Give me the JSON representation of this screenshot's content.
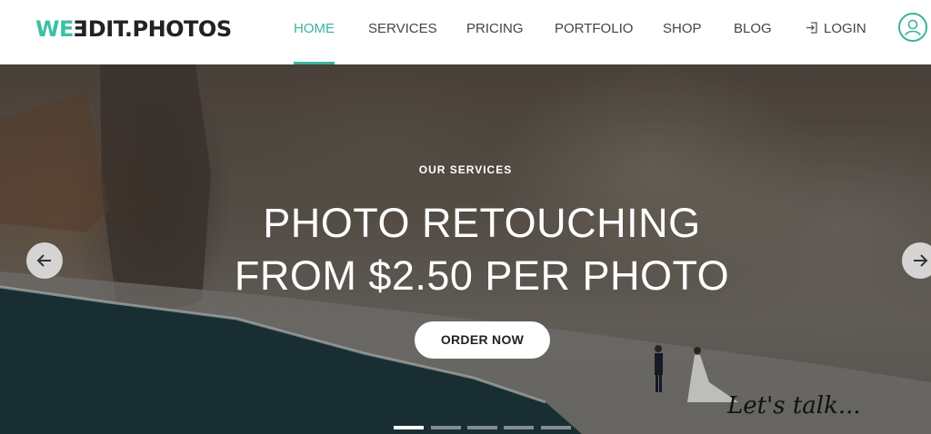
{
  "header": {
    "logo": {
      "we": "WE",
      "e": "E",
      "rest": "DIT.PHOTOS"
    },
    "nav": [
      {
        "label": "HOME",
        "active": true
      },
      {
        "label": "SERVICES"
      },
      {
        "label": "PRICING"
      },
      {
        "label": "PORTFOLIO"
      },
      {
        "label": "SHOP"
      },
      {
        "label": "BLOG"
      }
    ],
    "login_label": "LOGIN",
    "login_icon": "login-arrow-icon",
    "user_icon": "user-avatar-icon"
  },
  "hero": {
    "eyebrow": "OUR SERVICES",
    "headline_line1": "PHOTO RETOUCHING",
    "headline_line2": "FROM $2.50 PER PHOTO",
    "cta_label": "ORDER NOW",
    "prev_icon": "arrow-left-icon",
    "next_icon": "arrow-right-icon",
    "slides_total": 5,
    "slide_active": 1
  },
  "chat_widget": {
    "label": "Let's talk..."
  },
  "colors": {
    "accent": "#3cb39b",
    "logo_accent": "#3cc0a6",
    "text": "#444444"
  }
}
